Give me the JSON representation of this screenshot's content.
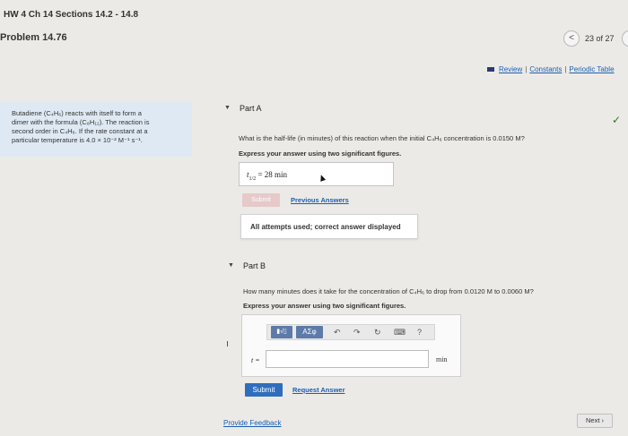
{
  "header": {
    "title": "HW 4 Ch 14 Sections 14.2 - 14.8",
    "problem": "Problem 14.76",
    "pager_prev": "<",
    "pager_count": "23 of 27"
  },
  "resource_links": {
    "review": "Review",
    "constants": "Constants",
    "periodic_table": "Periodic Table",
    "separator": "|"
  },
  "problem_statement": {
    "line1": "Butadiene (C₄H₆) reacts with itself to form a",
    "line2": "dimer with the formula (C₈H₁₂). The reaction is",
    "line3": "second order in C₄H₆. If the rate constant at a",
    "line4": "particular temperature is 4.0 × 10⁻² M⁻¹ s⁻¹."
  },
  "part_a": {
    "label": "Part A",
    "question": "What is the half-life (in minutes) of this reaction when the initial C₄H₆ concentration is 0.0150 M?",
    "instruction": "Express your answer using two significant figures.",
    "answer_var": "t",
    "answer_sub": "1/2",
    "answer_value": "= 28 min",
    "submit_label": "Submit",
    "previous_answers_label": "Previous Answers",
    "attempts_message": "All attempts used; correct answer displayed",
    "status_icon": "check-icon"
  },
  "part_b": {
    "label": "Part B",
    "question": "How many minutes does it take for the concentration of C₄H₆ to drop from 0.0120 M to 0.0060 M?",
    "instruction": "Express your answer using two significant figures.",
    "toolbar": {
      "templates": "▮√▯",
      "symbols": "ΑΣφ",
      "undo": "↶",
      "redo": "↷",
      "reset": "↻",
      "keyboard": "⌨",
      "help": "?"
    },
    "var_label": "t =",
    "input_value": "",
    "unit": "min",
    "submit_label": "Submit",
    "request_answer_label": "Request Answer"
  },
  "footer": {
    "feedback": "Provide Feedback",
    "next": "Next ›"
  }
}
